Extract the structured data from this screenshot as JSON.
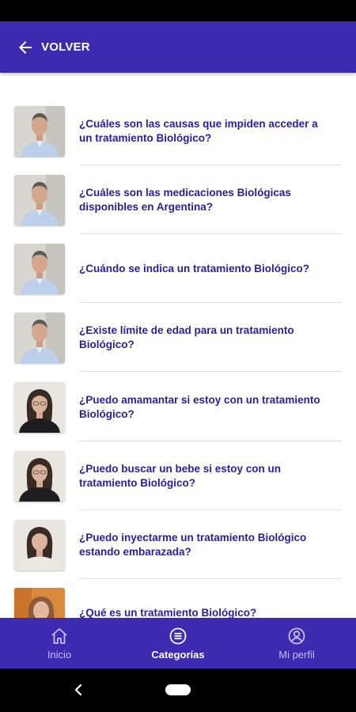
{
  "app_bar": {
    "back_label": "VOLVER"
  },
  "items": [
    {
      "question": "¿Cuáles son las causas que impiden acceder a un tratamiento Biológico?"
    },
    {
      "question": "¿Cuáles son las medicaciones Biológicas disponibles en Argentina?"
    },
    {
      "question": "¿Cuándo se indica un tratamiento Biológico?"
    },
    {
      "question": "¿Existe límite de edad para un tratamiento Biológico?"
    },
    {
      "question": "¿Puedo amamantar si estoy con un tratamiento Biológico?"
    },
    {
      "question": "¿Puedo buscar un bebe si estoy con un tratamiento Biológico?"
    },
    {
      "question": "¿Puedo inyectarme un tratamiento Biológico estando embarazada?"
    },
    {
      "question": "¿Qué es un tratamiento Biológico?"
    }
  ],
  "bottom_nav": {
    "inicio": "Inicio",
    "categorias": "Categorías",
    "perfil": "Mi perfil"
  },
  "colors": {
    "primary": "#3d2ab0",
    "question_text": "#2a1e9e"
  },
  "icons": [
    "arrow-left-icon",
    "home-icon",
    "list-icon",
    "user-circle-icon"
  ]
}
